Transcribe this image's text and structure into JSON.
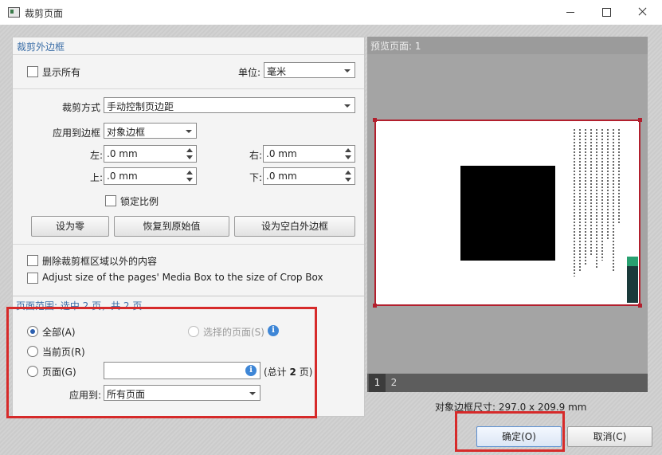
{
  "window": {
    "title": "裁剪页面"
  },
  "crop_margins": {
    "section_title": "裁剪外边框",
    "show_all_label": "显示所有",
    "unit_label": "单位:",
    "unit_value": "毫米",
    "crop_method_label": "裁剪方式",
    "crop_method_value": "手动控制页边距",
    "apply_to_box_label": "应用到边框",
    "apply_to_box_value": "对象边框",
    "left_label": "左:",
    "left_value": ".0 mm",
    "right_label": "右:",
    "right_value": ".0 mm",
    "top_label": "上:",
    "top_value": ".0 mm",
    "bottom_label": "下:",
    "bottom_value": ".0 mm",
    "lock_ratio_label": "锁定比例",
    "set_zero_button": "设为零",
    "restore_original_button": "恢复到原始值",
    "set_white_margins_button": "设为空白外边框",
    "delete_outside_label": "删除裁剪框区域以外的内容",
    "adjust_media_box_label": "Adjust size of the pages' Media Box to the size of Crop Box"
  },
  "page_range": {
    "section_title": "页面范围: 选中 2 页，共 2 页",
    "all_label": "全部(A)",
    "selected_pages_label": "选择的页面(S)",
    "current_page_label": "当前页(R)",
    "pages_label": "页面(G)",
    "pages_value": "",
    "total_prefix": "(总计",
    "total_count": "2",
    "total_suffix": "页)",
    "apply_to_label": "应用到:",
    "apply_to_value": "所有页面"
  },
  "preview": {
    "title": "预览页面: 1",
    "thumbnails": [
      "1",
      "2"
    ],
    "dimensions_text": "对象边框尺寸: 297.0 x 209.9 mm"
  },
  "buttons": {
    "ok": "确定(O)",
    "cancel": "取消(C)"
  },
  "colors": {
    "crop_frame": "#b21f2d",
    "annotation_highlight": "#d62a2a",
    "section_title": "#3d6fa8"
  }
}
